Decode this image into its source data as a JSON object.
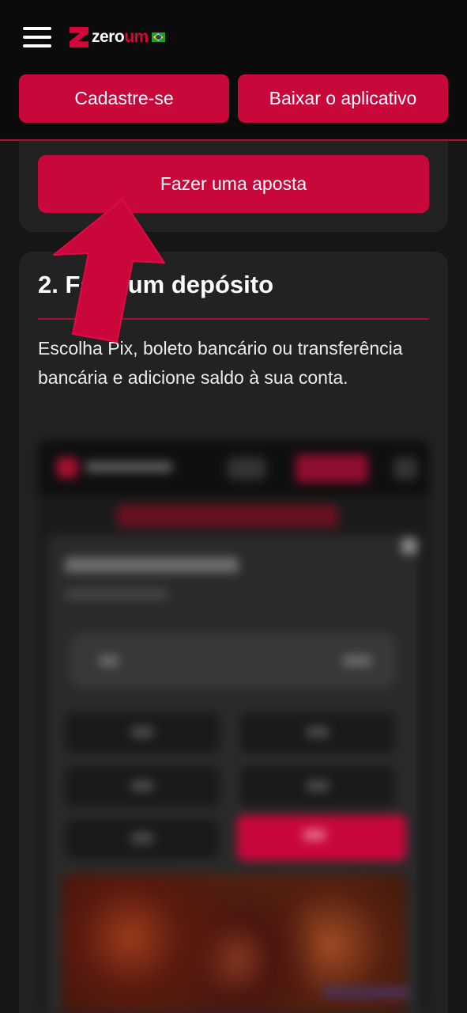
{
  "header": {
    "logo_prefix": "zero",
    "logo_suffix": "um",
    "logo_mark": "Z",
    "signup_label": "Cadastre-se",
    "download_app_label": "Baixar o aplicativo"
  },
  "step1": {
    "bet_button_label": "Fazer uma aposta"
  },
  "step2": {
    "title": "2. Faça um depósito",
    "description": "Escolha Pix, boleto bancário ou transferência bancária e adicione saldo à sua conta."
  },
  "colors": {
    "accent": "#c8073a",
    "header_bg": "#0b0b0b",
    "page_bg": "#161616",
    "card_bg": "#222222"
  },
  "icons": {
    "menu": "hamburger-icon",
    "logo": "zeroum-logo",
    "flag": "brazil-flag-icon",
    "arrow": "pointer-arrow-icon"
  }
}
